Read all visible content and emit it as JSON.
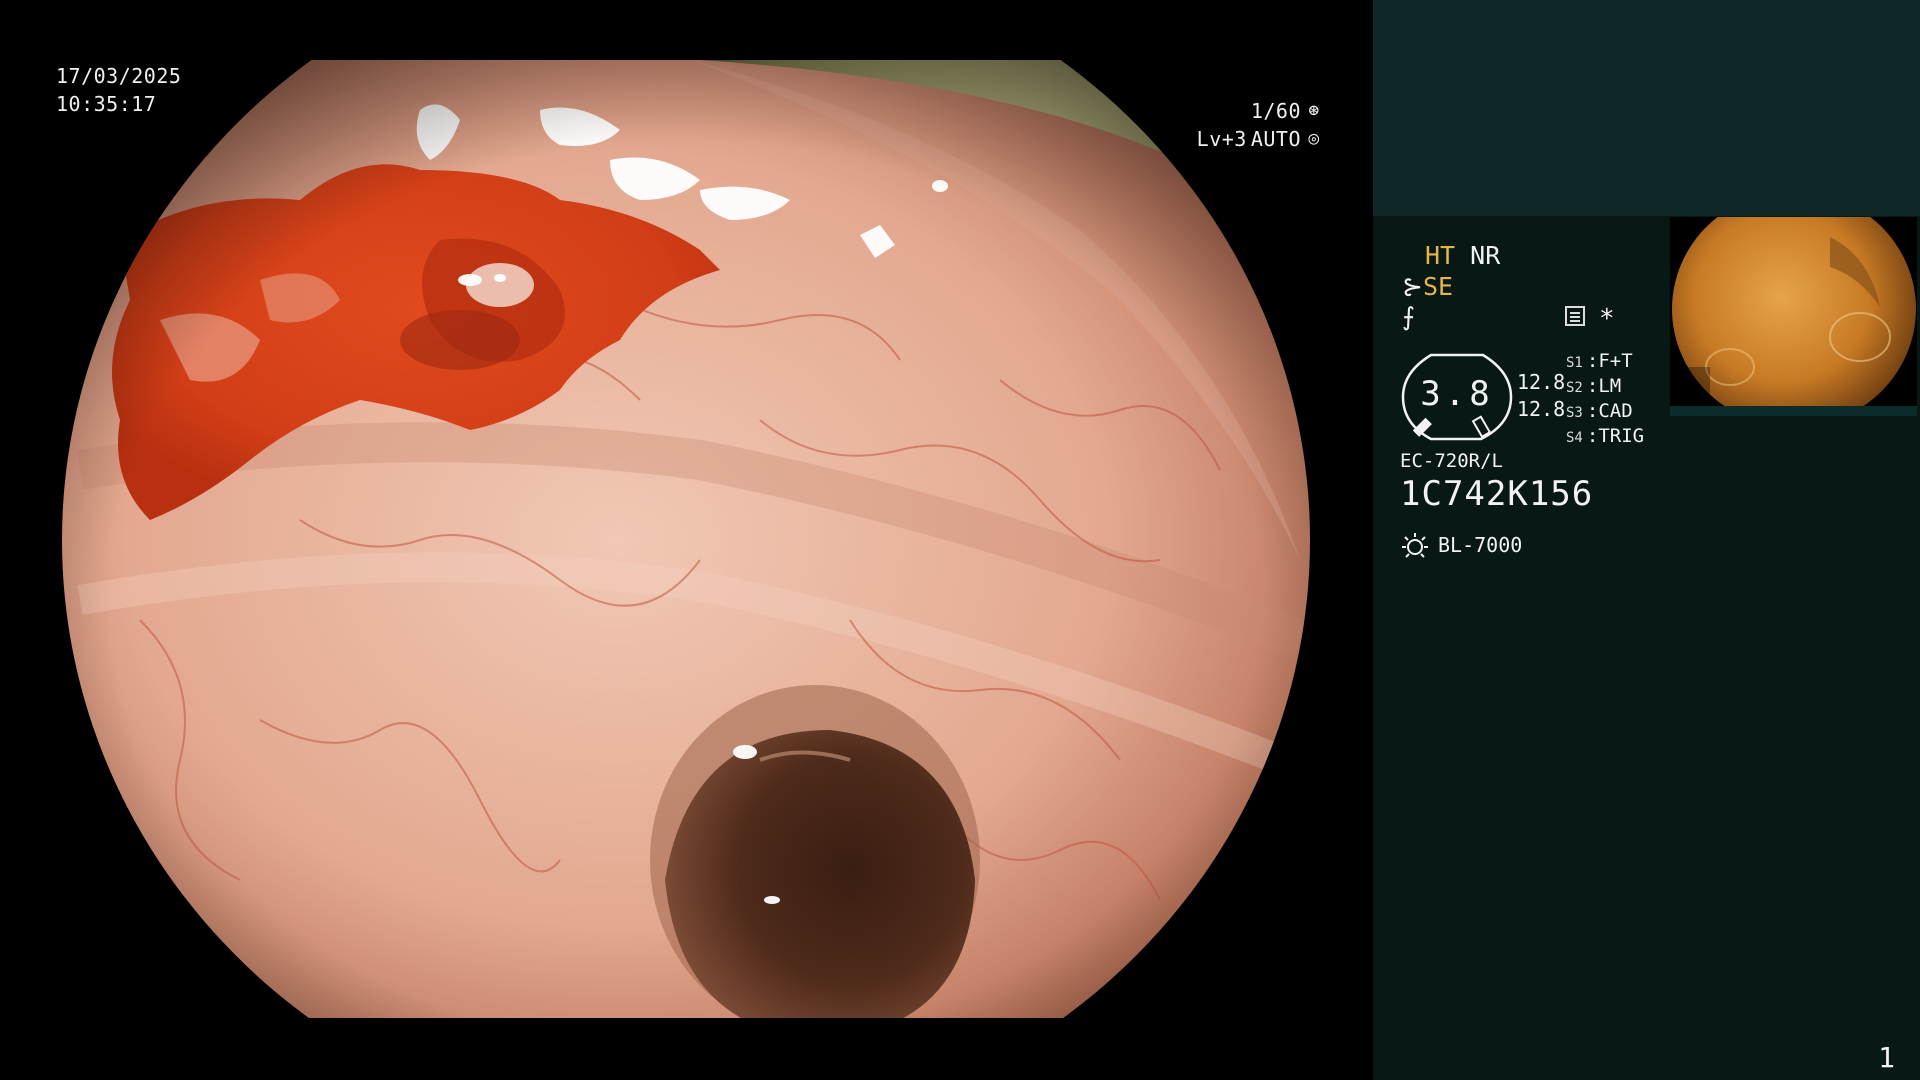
{
  "osd": {
    "date": "17/03/2025",
    "time": "10:35:17",
    "shutter": "1/60",
    "shutter_icon": "aperture-icon",
    "light_level": "Lv+3",
    "exposure_mode": "AUTO",
    "exposure_icon": "iris-icon"
  },
  "panel": {
    "mode_ht": "HT",
    "mode_nr": "NR",
    "se_label": "SE",
    "settings_icon": "settings-panel-icon",
    "asterisk": "*",
    "gauge_value": "3.8",
    "gauge_readings": [
      "12.8",
      "12.8"
    ],
    "switches": [
      {
        "key": "S1",
        "value": "F+T"
      },
      {
        "key": "S2",
        "value": "LM"
      },
      {
        "key": "S3",
        "value": "CAD"
      },
      {
        "key": "S4",
        "value": "TRIG"
      }
    ],
    "scope_model": "EC-720R/L",
    "scope_serial": "1C742K156",
    "light_source": "BL-7000",
    "page_number": "1"
  },
  "colors": {
    "accent_amber": "#e6b64c",
    "panel_top": "#0e2827",
    "panel_body": "#071815",
    "blood": "#d9411f",
    "mucosa": "#e7b09c"
  }
}
